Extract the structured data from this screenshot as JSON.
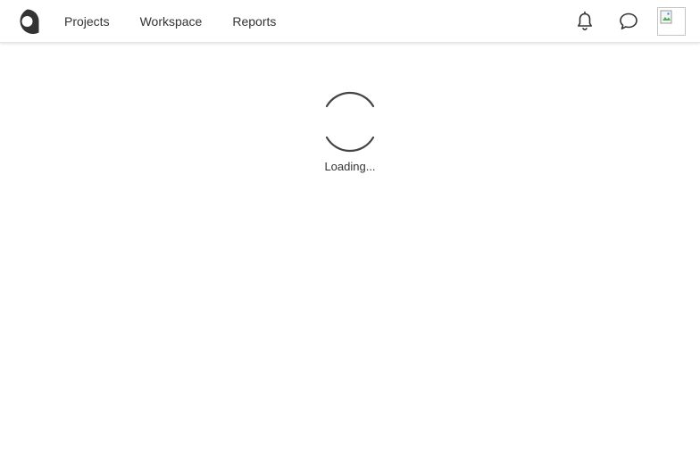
{
  "header": {
    "nav": {
      "projects_label": "Projects",
      "workspace_label": "Workspace",
      "reports_label": "Reports"
    },
    "icons": {
      "logo": "brand-logo-icon",
      "notifications": "bell-icon",
      "messages": "chat-bubble-icon",
      "avatar": "broken-image-icon"
    }
  },
  "main": {
    "loading_text": "Loading..."
  },
  "colors": {
    "logo": "#333333",
    "spinner": "#444444",
    "text": "#333333"
  }
}
